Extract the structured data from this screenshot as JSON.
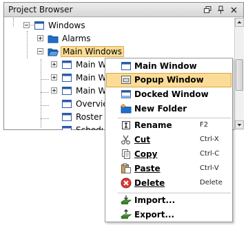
{
  "panel": {
    "title": "Project Browser",
    "buttons": [
      "restore-icon",
      "pin-icon",
      "close-icon"
    ]
  },
  "tree": {
    "nodes": [
      {
        "label": "Windows",
        "icon": "windows-folder-icon"
      },
      {
        "label": "Alarms",
        "icon": "folder-icon"
      },
      {
        "label": "Main Windows",
        "icon": "open-folder-icon",
        "selected": true
      },
      {
        "label": "Main Win",
        "icon": "window-icon"
      },
      {
        "label": "Main Wi",
        "icon": "window-icon"
      },
      {
        "label": "Main Wi",
        "icon": "window-icon"
      },
      {
        "label": "Overvie",
        "icon": "window-icon"
      },
      {
        "label": "Roster M",
        "icon": "window-icon"
      },
      {
        "label": "Schedul",
        "icon": "window-icon"
      }
    ]
  },
  "context_menu": {
    "items": [
      {
        "label": "Main Window",
        "shortcut": "",
        "icon": "main-window-icon"
      },
      {
        "label": "Popup Window",
        "shortcut": "",
        "icon": "popup-window-icon",
        "highlighted": true
      },
      {
        "label": "Docked Window",
        "shortcut": "",
        "icon": "docked-window-icon"
      },
      {
        "label": "New Folder",
        "shortcut": "",
        "icon": "new-folder-icon"
      },
      {
        "label": "Rename",
        "shortcut": "F2",
        "icon": "rename-icon"
      },
      {
        "label": "Cut",
        "shortcut": "Ctrl-X",
        "icon": "scissors-icon"
      },
      {
        "label": "Copy",
        "shortcut": "Ctrl-C",
        "icon": "copy-icon"
      },
      {
        "label": "Paste",
        "shortcut": "Ctrl-V",
        "icon": "paste-icon"
      },
      {
        "label": "Delete",
        "shortcut": "Delete",
        "icon": "delete-icon"
      },
      {
        "label": "Import...",
        "shortcut": "",
        "icon": "import-icon"
      },
      {
        "label": "Export...",
        "shortcut": "",
        "icon": "export-icon"
      }
    ]
  },
  "colors": {
    "selection": "#fbdc96",
    "selection_border": "#d9a540",
    "folder": "#1e6fc9",
    "window_icon": "#2a5aa8"
  }
}
